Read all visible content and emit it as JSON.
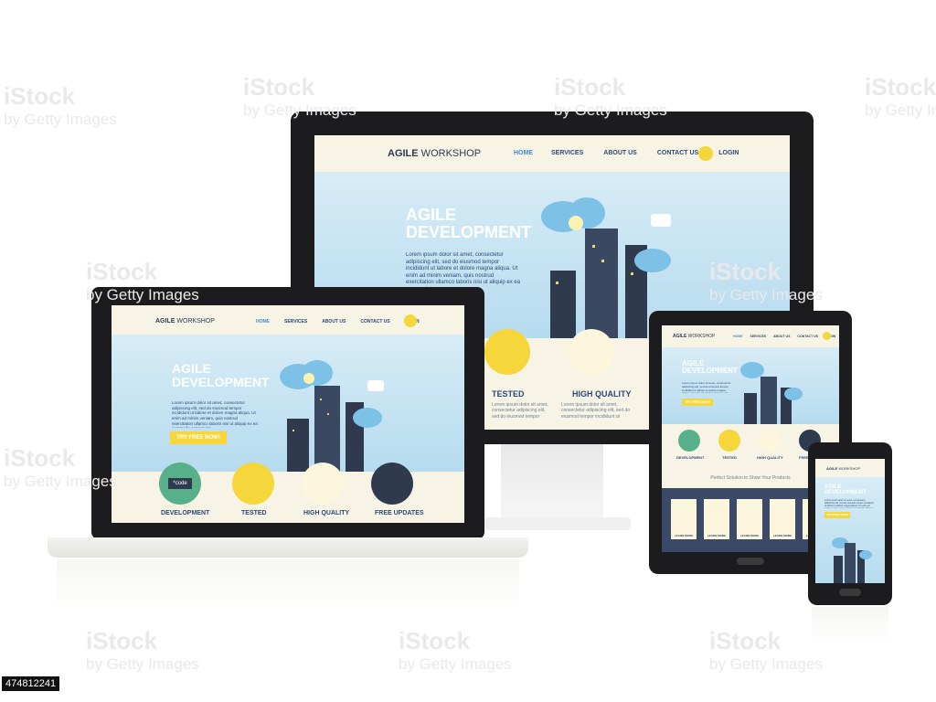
{
  "site": {
    "logo_bold": "AGILE",
    "logo_rest": " WORKSHOP",
    "nav": [
      "HOME",
      "SERVICES",
      "ABOUT US",
      "CONTACT US",
      "LOGIN"
    ],
    "hero_title_1": "AGILE",
    "hero_title_2": "DEVELOPMENT",
    "hero_text": "Lorem ipsum dolor sit amet, consectetur adipiscing elit, sed do eiusmod tempor incididunt ut labore et dolore magna aliqua. Ut enim ad minim veniam, quis nostrud exercitation ullamco laboris nisi ut aliquip ex ea commodo consequat.",
    "cta": "TRY FREE NOW!",
    "code_label": "*code",
    "features": [
      "DEVELOPMENT",
      "TESTED",
      "HIGH QUALITY",
      "FREE UPDATES"
    ],
    "feature_text": "Lorem ipsum dolor sit amet, consectetur adipiscing elit, sed do eiusmod tempor incididunt ut labore et dolore magna aliqua. Ut enim ad minim veniam, quis nostrud exercitation ullamco laboris nisi ut aliquip ex ea commodo consequat.",
    "tablet_heading": "Perfect Solution to Show Your Products",
    "learn_more": "LEARN MORE",
    "monitor_features": [
      "TESTED",
      "HIGH QUALITY"
    ]
  },
  "watermark": {
    "brand": "iStock",
    "by": "by Getty Images"
  },
  "image_id": "474812241",
  "colors": {
    "accent_yellow": "#f5d63b",
    "hero_blue": "#b6dbef",
    "device_black": "#1c1c1e",
    "nav_blue": "#2b4a7a",
    "active_blue": "#3b8fd0"
  }
}
